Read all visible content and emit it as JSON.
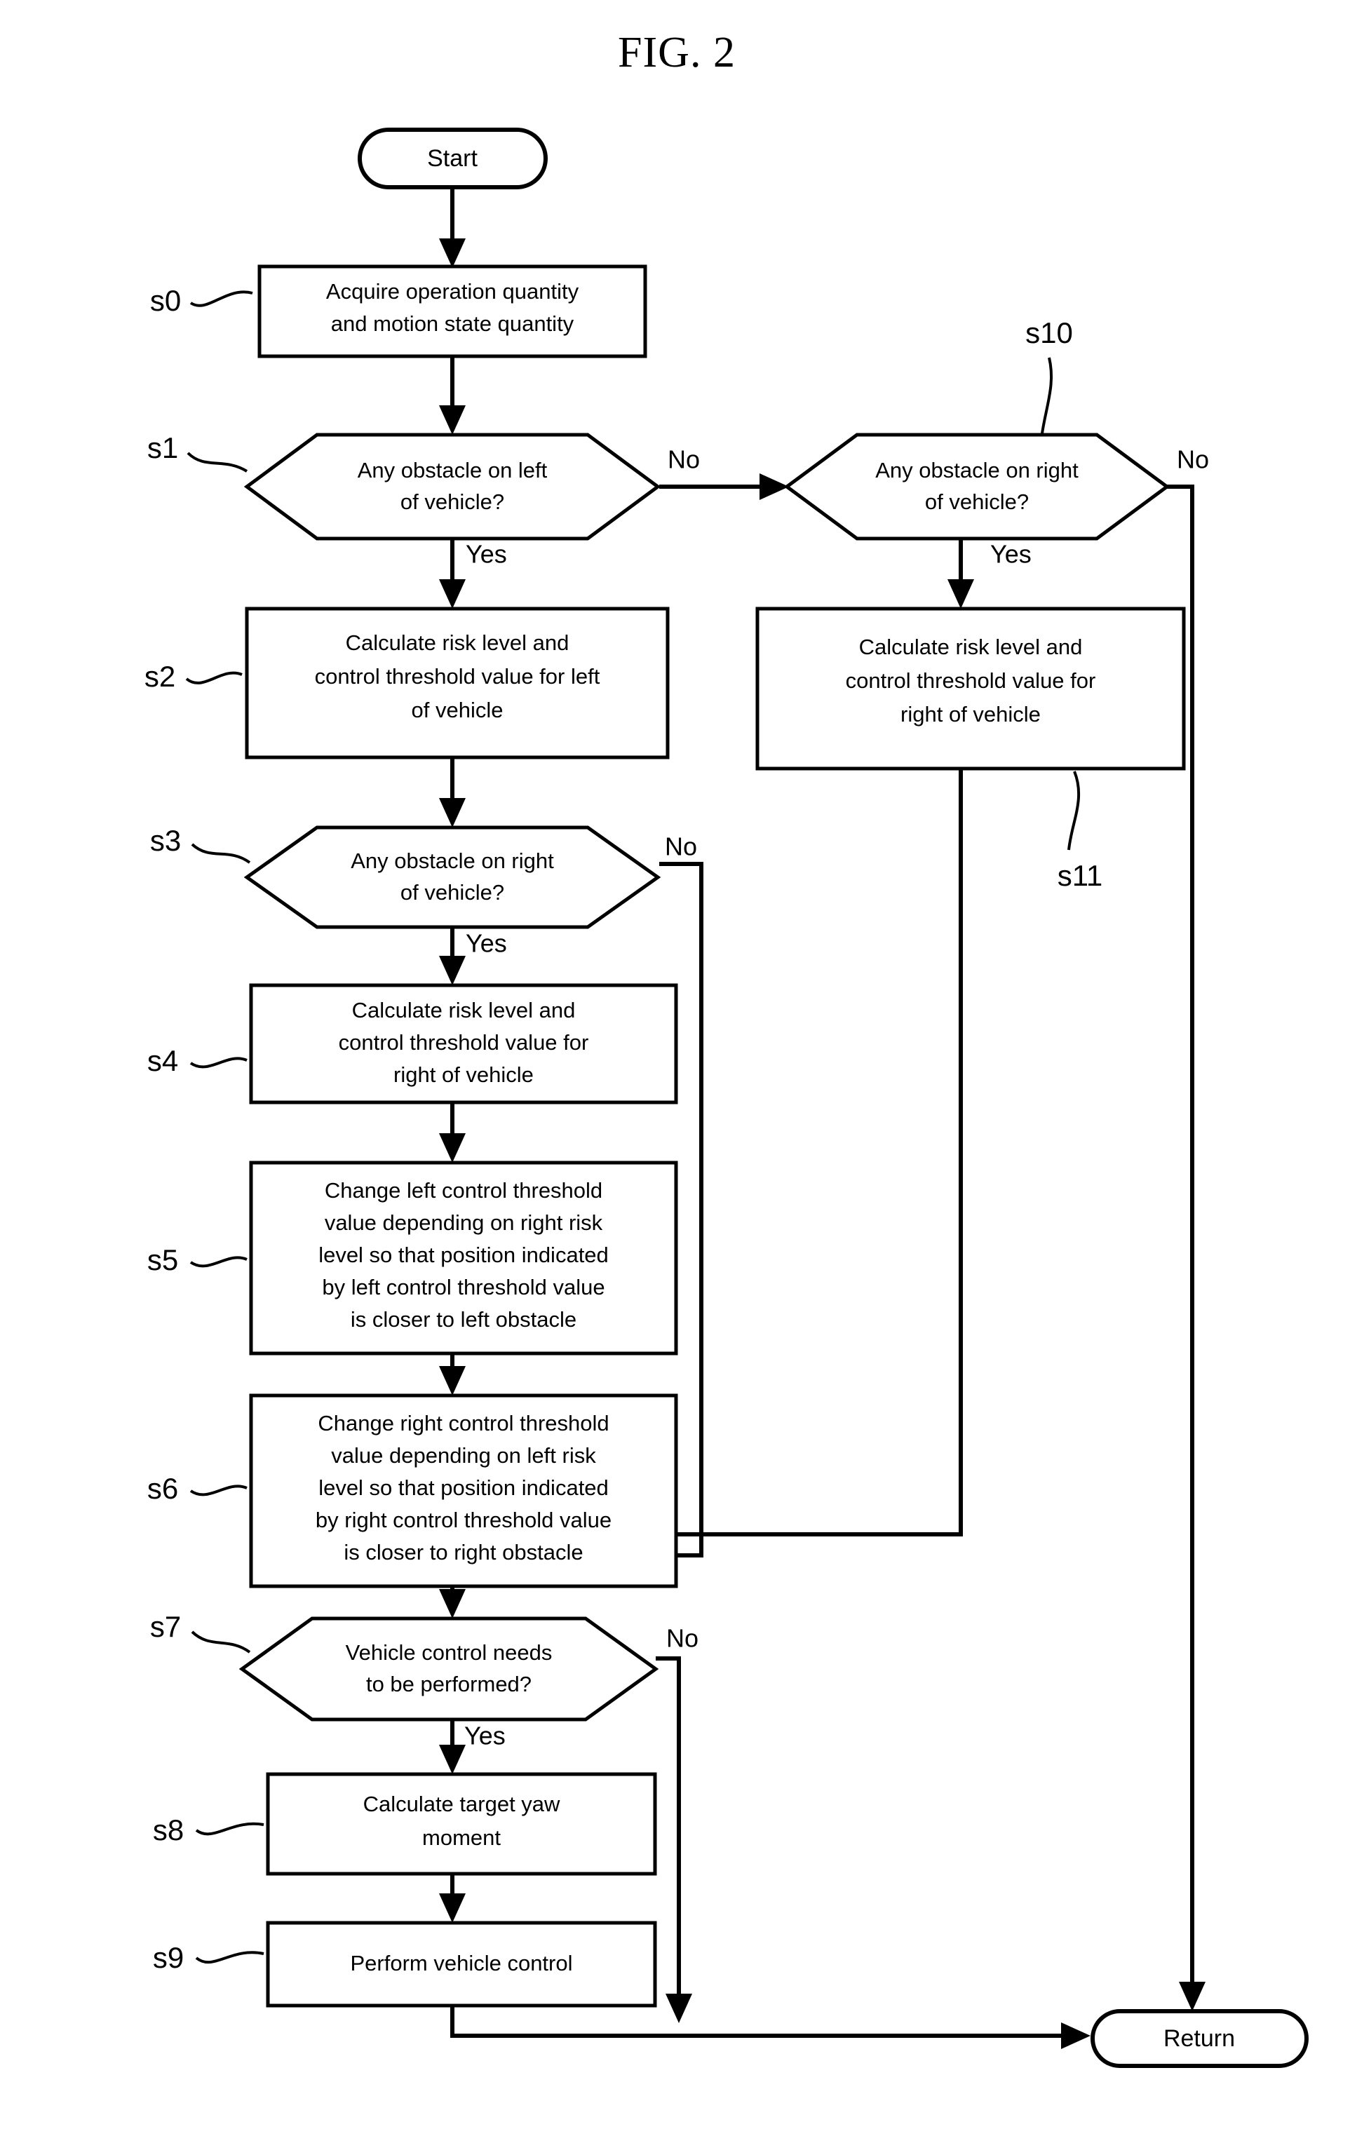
{
  "figure": {
    "title": "FIG. 2",
    "kind": "process-flowchart"
  },
  "terminators": {
    "start": "Start",
    "return": "Return"
  },
  "branch_labels": {
    "yes": "Yes",
    "no": "No"
  },
  "steps": [
    {
      "id": "s0",
      "label": "s0",
      "shape": "process",
      "lines": [
        "Acquire operation quantity",
        "and motion state quantity"
      ]
    },
    {
      "id": "s1",
      "label": "s1",
      "shape": "decision",
      "lines": [
        "Any obstacle on left",
        "of vehicle?"
      ]
    },
    {
      "id": "s2",
      "label": "s2",
      "shape": "process",
      "lines": [
        "Calculate risk level and",
        "control threshold value for left",
        "of vehicle"
      ]
    },
    {
      "id": "s3",
      "label": "s3",
      "shape": "decision",
      "lines": [
        "Any obstacle on right",
        "of vehicle?"
      ]
    },
    {
      "id": "s4",
      "label": "s4",
      "shape": "process",
      "lines": [
        "Calculate risk level and",
        "control threshold value for",
        "right of vehicle"
      ]
    },
    {
      "id": "s5",
      "label": "s5",
      "shape": "process",
      "lines": [
        "Change left control threshold",
        "value depending on right risk",
        "level so that position indicated",
        "by left control threshold value",
        "is closer to left obstacle"
      ]
    },
    {
      "id": "s6",
      "label": "s6",
      "shape": "process",
      "lines": [
        "Change right control threshold",
        "value depending on left risk",
        "level so that position indicated",
        "by right control threshold value",
        "is closer to right obstacle"
      ]
    },
    {
      "id": "s7",
      "label": "s7",
      "shape": "decision",
      "lines": [
        "Vehicle control needs",
        "to be performed?"
      ]
    },
    {
      "id": "s8",
      "label": "s8",
      "shape": "process",
      "lines": [
        "Calculate target yaw",
        "moment"
      ]
    },
    {
      "id": "s9",
      "label": "s9",
      "shape": "process",
      "lines": [
        "Perform vehicle control"
      ]
    },
    {
      "id": "s10",
      "label": "s10",
      "shape": "decision",
      "lines": [
        "Any obstacle on right",
        "of vehicle?"
      ]
    },
    {
      "id": "s11",
      "label": "s11",
      "shape": "process",
      "lines": [
        "Calculate risk level and",
        "control threshold value for",
        "right of vehicle"
      ]
    }
  ],
  "edges": [
    {
      "from": "start",
      "to": "s0",
      "label": ""
    },
    {
      "from": "s0",
      "to": "s1",
      "label": ""
    },
    {
      "from": "s1",
      "to": "s2",
      "label": "Yes"
    },
    {
      "from": "s1",
      "to": "s10",
      "label": "No"
    },
    {
      "from": "s2",
      "to": "s3",
      "label": ""
    },
    {
      "from": "s3",
      "to": "s4",
      "label": "Yes"
    },
    {
      "from": "s3",
      "to": "s7",
      "label": "No"
    },
    {
      "from": "s4",
      "to": "s5",
      "label": ""
    },
    {
      "from": "s5",
      "to": "s6",
      "label": ""
    },
    {
      "from": "s6",
      "to": "s7",
      "label": ""
    },
    {
      "from": "s7",
      "to": "s8",
      "label": "Yes"
    },
    {
      "from": "s7",
      "to": "return",
      "label": "No"
    },
    {
      "from": "s8",
      "to": "s9",
      "label": ""
    },
    {
      "from": "s9",
      "to": "return",
      "label": ""
    },
    {
      "from": "s10",
      "to": "s11",
      "label": "Yes"
    },
    {
      "from": "s10",
      "to": "return",
      "label": "No"
    },
    {
      "from": "s11",
      "to": "s7",
      "label": ""
    }
  ],
  "colors": {
    "ink": "#000000",
    "paper": "#ffffff"
  }
}
